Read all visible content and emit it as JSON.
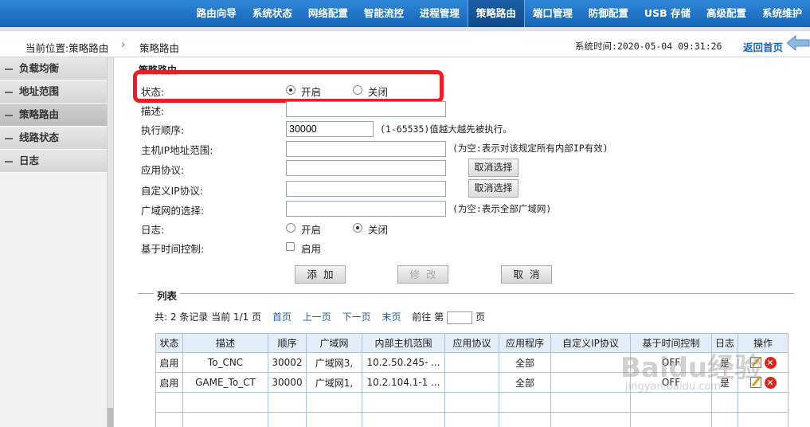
{
  "nav": {
    "items": [
      "路由向导",
      "系统状态",
      "网络配置",
      "智能流控",
      "进程管理",
      "策略路由",
      "端口管理",
      "防御配置",
      "USB 存储",
      "高级配置",
      "系统维护"
    ],
    "active_index": 5
  },
  "breadcrumb": {
    "location": "当前位置:策略路由",
    "current": "策略路由",
    "system_time": "系统时间:2020-05-04 09:31:26",
    "home_link": "返回首页"
  },
  "sidebar": {
    "items": [
      {
        "label": "负载均衡"
      },
      {
        "label": "地址范围"
      },
      {
        "label": "策略路由"
      },
      {
        "label": "线路状态"
      },
      {
        "label": "日志"
      }
    ],
    "active_index": 2
  },
  "form": {
    "section_title": "策略路由",
    "status_label": "状态:",
    "status_on": "开启",
    "status_off": "关闭",
    "status_value": "开启",
    "desc_label": "描述:",
    "desc_value": "",
    "order_label": "执行顺序:",
    "order_value": "30000",
    "order_hint": "(1-65535)值越大越先被执行。",
    "host_range_label": "主机IP地址范围:",
    "host_range_hint": "(为空:表示对该规定所有内部IP有效)",
    "app_proto_label": "应用协议:",
    "cancel_select_1": "取消选择",
    "custom_ip_proto_label": "自定义IP协议:",
    "cancel_select_2": "取消选择",
    "wan_label": "广域网的选择:",
    "wan_hint": "(为空:表示全部广域网)",
    "log_label": "日志:",
    "log_on": "开启",
    "log_off": "关闭",
    "log_value": "关闭",
    "time_ctrl_label": "基于时间控制:",
    "time_ctrl_check_label": "启用",
    "btn_add": "添加",
    "btn_modify": "修改",
    "btn_cancel": "取消"
  },
  "list": {
    "title": "列表",
    "summary": "共: 2 条记录 当前 1/1 页",
    "first": "首页",
    "prev": "上一页",
    "next": "下一页",
    "last": "末页",
    "goto_prefix": "前往 第",
    "goto_suffix": "页",
    "headers": [
      "状态",
      "描述",
      "顺序",
      "广域网",
      "内部主机范围",
      "应用协议",
      "应用程序",
      "自定义IP协议",
      "基于时间控制",
      "日志",
      "操作"
    ],
    "rows": [
      [
        "启用",
        "To_CNC",
        "30002",
        "广域网3,",
        "10.2.50.245- ...",
        "",
        "全部",
        "",
        "OFF",
        "是"
      ],
      [
        "启用",
        "GAME_To_CT",
        "30000",
        "广域网1,",
        "10.2.104.1-1 ...",
        "",
        "全部",
        "",
        "OFF",
        "是"
      ]
    ]
  },
  "watermark": {
    "text": "Baidu经验",
    "sub": "jingyan.baidu.com"
  }
}
